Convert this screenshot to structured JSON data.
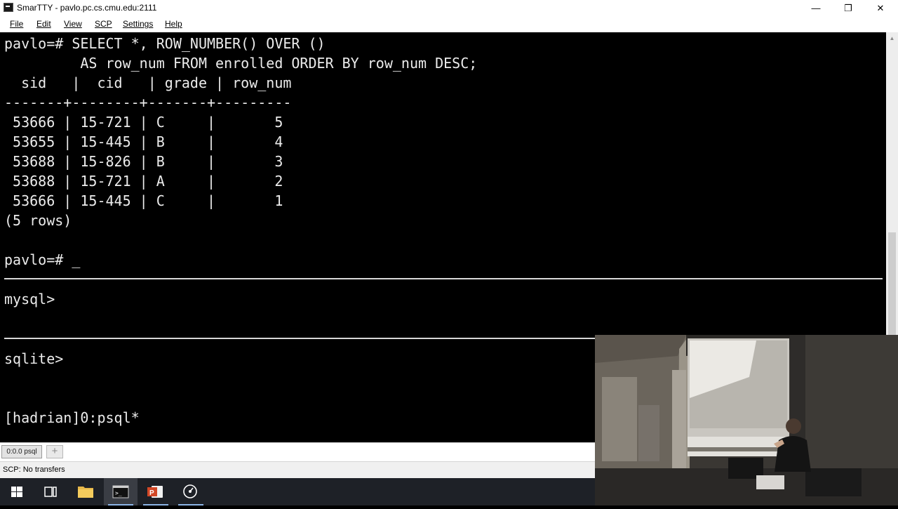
{
  "window": {
    "title": "SmarTTY - pavlo.pc.cs.cmu.edu:2111",
    "controls": {
      "minimize": "—",
      "maximize": "❐",
      "close": "✕"
    }
  },
  "menu": [
    "File",
    "Edit",
    "View",
    "SCP",
    "Settings",
    "Help"
  ],
  "terminal": {
    "query_line1": "pavlo=# SELECT *, ROW_NUMBER() OVER ()",
    "query_line2": "         AS row_num FROM enrolled ORDER BY row_num DESC;",
    "header": "  sid   |  cid   | grade | row_num",
    "divider": "-------+--------+-------+---------",
    "rows": [
      " 53666 | 15-721 | C     |       5",
      " 53655 | 15-445 | B     |       4",
      " 53688 | 15-826 | B     |       3",
      " 53688 | 15-721 | A     |       2",
      " 53666 | 15-445 | C     |       1"
    ],
    "row_count": "(5 rows)",
    "prompt_psql": "pavlo=# ",
    "cursor": "_",
    "prompt_mysql": "mysql>",
    "prompt_sqlite": "sqlite>",
    "tmux_status": "[hadrian]0:psql*"
  },
  "tabs": {
    "active_label": "0:0.0 psql",
    "add_icon": "+"
  },
  "status": {
    "text": "SCP: No transfers"
  },
  "taskbar": {
    "items": [
      "windows-start",
      "task-view",
      "file-explorer",
      "smartty-terminal",
      "powerpoint",
      "browser"
    ]
  }
}
